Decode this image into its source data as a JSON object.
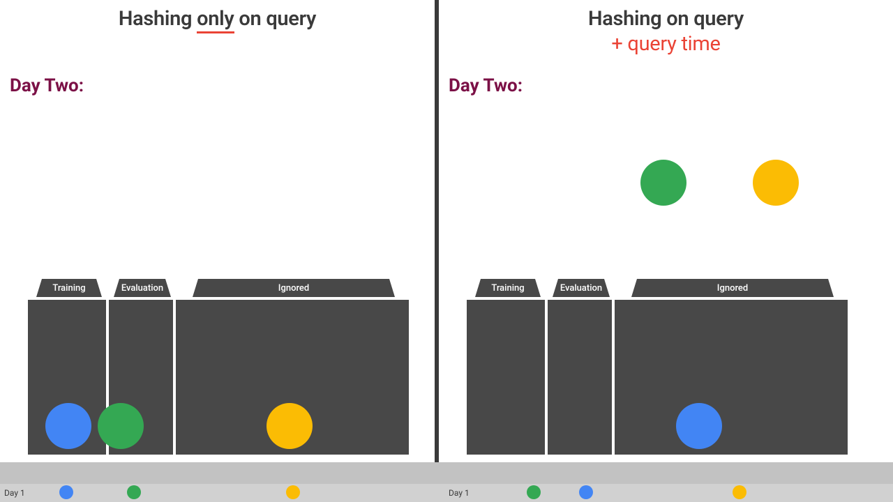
{
  "left": {
    "title1_pre": "Hashing ",
    "title1_em": "only",
    "title1_post": " on query",
    "day": "Day Two:"
  },
  "right": {
    "title1": "Hashing on query",
    "title2": "+ query time",
    "day": "Day Two:"
  },
  "buckets": {
    "training": "Training",
    "evaluation": "Evaluation",
    "ignored": "Ignored"
  },
  "footer": {
    "day1": "Day 1"
  },
  "colors": {
    "blue": "#4285f4",
    "green": "#34a853",
    "yellow": "#fbbc04",
    "accent": "#ea4335",
    "gray": "#484848"
  }
}
